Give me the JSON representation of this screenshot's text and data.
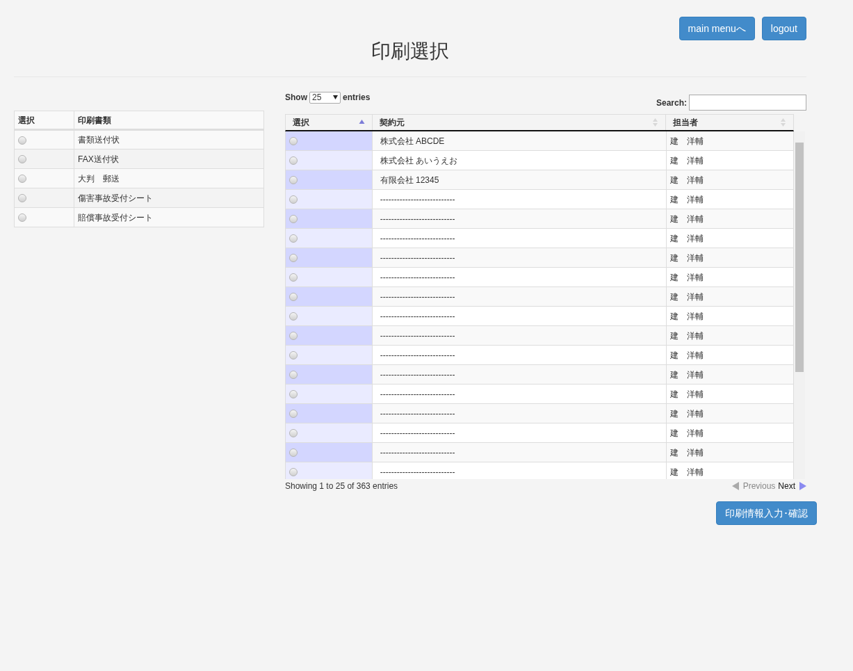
{
  "header_buttons": [
    "main menuへ",
    "logout"
  ],
  "title": "印刷選択",
  "document_table": {
    "columns": [
      "選択",
      "印刷書類"
    ],
    "rows": [
      {
        "name": "書類送付状",
        "selected": false
      },
      {
        "name": "FAX送付状",
        "selected": false
      },
      {
        "name": "大判　郵送",
        "selected": false
      },
      {
        "name": "傷害事故受付シート",
        "selected": false
      },
      {
        "name": "賠償事故受付シート",
        "selected": false
      }
    ]
  },
  "length_control": {
    "before": "Show",
    "value": "25",
    "after": "entries"
  },
  "search": {
    "label": "Search:"
  },
  "contract_table": {
    "columns": [
      {
        "label": "選択",
        "sorted": true
      },
      {
        "label": "契約元",
        "sorted": false
      },
      {
        "label": "担当者",
        "sorted": false
      }
    ],
    "rows": [
      {
        "contractor": "株式会社 ABCDE",
        "person": "建　洋輔",
        "selected": false
      },
      {
        "contractor": "株式会社 あいうえお",
        "person": "建　洋輔",
        "selected": false
      },
      {
        "contractor": "有限会社 12345",
        "person": "建　洋輔",
        "selected": false
      },
      {
        "contractor": "---------------------------",
        "person": "建　洋輔",
        "selected": false
      },
      {
        "contractor": "---------------------------",
        "person": "建　洋輔",
        "selected": false
      },
      {
        "contractor": "---------------------------",
        "person": "建　洋輔",
        "selected": false
      },
      {
        "contractor": "---------------------------",
        "person": "建　洋輔",
        "selected": false
      },
      {
        "contractor": "---------------------------",
        "person": "建　洋輔",
        "selected": false
      },
      {
        "contractor": "---------------------------",
        "person": "建　洋輔",
        "selected": false
      },
      {
        "contractor": "---------------------------",
        "person": "建　洋輔",
        "selected": false
      },
      {
        "contractor": "---------------------------",
        "person": "建　洋輔",
        "selected": false
      },
      {
        "contractor": "---------------------------",
        "person": "建　洋輔",
        "selected": false
      },
      {
        "contractor": "---------------------------",
        "person": "建　洋輔",
        "selected": false
      },
      {
        "contractor": "---------------------------",
        "person": "建　洋輔",
        "selected": false
      },
      {
        "contractor": "---------------------------",
        "person": "建　洋輔",
        "selected": false
      },
      {
        "contractor": "---------------------------",
        "person": "建　洋輔",
        "selected": false
      },
      {
        "contractor": "---------------------------",
        "person": "建　洋輔",
        "selected": false
      },
      {
        "contractor": "---------------------------",
        "person": "建　洋輔",
        "selected": false
      }
    ]
  },
  "info": "Showing 1 to 25 of 363 entries",
  "pagination": [
    {
      "label": "Previous",
      "disabled": true
    },
    {
      "label": "Next",
      "disabled": false
    }
  ],
  "confirm_button": "印刷情報入力･確認"
}
